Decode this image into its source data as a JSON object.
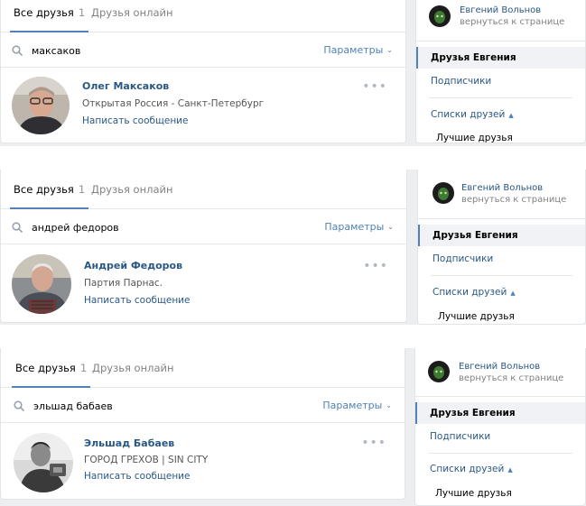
{
  "colors": {
    "accent": "#5181b8",
    "link": "#2a5885",
    "muted": "#828282",
    "bg": "#edeef0"
  },
  "blocks": [
    {
      "tab_all": "Все друзья",
      "tab_all_count": "1",
      "tab_online": "Друзья онлайн",
      "search_value": "максаков",
      "params_label": "Параметры",
      "person": {
        "name": "Олег Максаков",
        "status": "Открытая Россия - Санкт-Петербург",
        "message_link": "Написать сообщение",
        "more_icon": "more-dots-icon"
      },
      "sidebar": {
        "owner_name": "Евгений Вольнов",
        "owner_back": "вернуться к странице",
        "friends_of": "Друзья Евгения",
        "followers": "Подписчики",
        "lists": "Списки друзей",
        "best": "Лучшие друзья"
      }
    },
    {
      "tab_all": "Все друзья",
      "tab_all_count": "1",
      "tab_online": "Друзья онлайн",
      "search_value": "андрей федоров",
      "params_label": "Параметры",
      "person": {
        "name": "Андрей Федоров",
        "status": "Партия Парнас.",
        "message_link": "Написать сообщение",
        "more_icon": "more-dots-icon"
      },
      "sidebar": {
        "owner_name": "Евгений Вольнов",
        "owner_back": "вернуться к странице",
        "friends_of": "Друзья Евгения",
        "followers": "Подписчики",
        "lists": "Списки друзей",
        "best": "Лучшие друзья"
      }
    },
    {
      "tab_all": "Все друзья",
      "tab_all_count": "1",
      "tab_online": "Друзья онлайн",
      "search_value": "эльшад бабаев",
      "params_label": "Параметры",
      "person": {
        "name": "Эльшад Бабаев",
        "status": "ГОРОД ГРЕХОВ | SIN CITY",
        "message_link": "Написать сообщение",
        "more_icon": "more-dots-icon"
      },
      "sidebar": {
        "owner_name": "Евгений Вольнов",
        "owner_back": "вернуться к странице",
        "friends_of": "Друзья Евгения",
        "followers": "Подписчики",
        "lists": "Списки друзей",
        "best": "Лучшие друзья"
      }
    }
  ]
}
